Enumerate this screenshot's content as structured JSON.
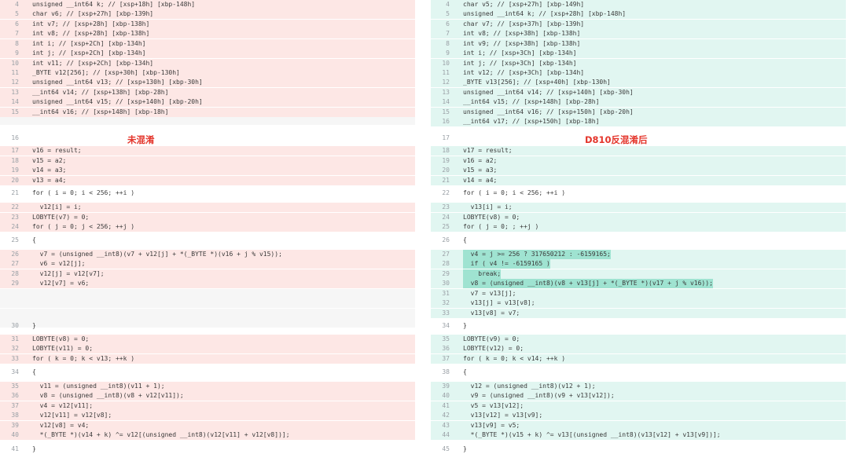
{
  "left_title": "未混淆",
  "right_title": "D810反混淆后",
  "left": [
    {
      "n": "4",
      "t": "unsigned __int64 k; // [xsp+18h] [xbp-148h]",
      "c": "del"
    },
    {
      "n": "5",
      "t": "char v6; // [xsp+27h] [xbp-139h]",
      "c": "del"
    },
    {
      "n": "6",
      "t": "int v7; // [xsp+28h] [xbp-138h]",
      "c": "del"
    },
    {
      "n": "7",
      "t": "int v8; // [xsp+28h] [xbp-138h]",
      "c": "del"
    },
    {
      "n": "8",
      "t": "int i; // [xsp+2Ch] [xbp-134h]",
      "c": "del"
    },
    {
      "n": "9",
      "t": "int j; // [xsp+2Ch] [xbp-134h]",
      "c": "del"
    },
    {
      "n": "10",
      "t": "int v11; // [xsp+2Ch] [xbp-134h]",
      "c": "del"
    },
    {
      "n": "11",
      "t": "_BYTE v12[256]; // [xsp+30h] [xbp-130h]",
      "c": "del"
    },
    {
      "n": "12",
      "t": "unsigned __int64 v13; // [xsp+130h] [xbp-30h]",
      "c": "del"
    },
    {
      "n": "13",
      "t": "__int64 v14; // [xsp+138h] [xbp-28h]",
      "c": "del"
    },
    {
      "n": "14",
      "t": "unsigned __int64 v15; // [xsp+140h] [xbp-20h]",
      "c": "del"
    },
    {
      "n": "15",
      "t": "__int64 v16; // [xsp+148h] [xbp-18h]",
      "c": "del"
    },
    {
      "n": "",
      "t": "",
      "c": "gap"
    },
    {
      "n": "16",
      "t": "",
      "c": ""
    },
    {
      "n": "17",
      "t": "v16 = result;",
      "c": "del"
    },
    {
      "n": "18",
      "t": "v15 = a2;",
      "c": "del"
    },
    {
      "n": "19",
      "t": "v14 = a3;",
      "c": "del"
    },
    {
      "n": "20",
      "t": "v13 = a4;",
      "c": "del"
    },
    {
      "n": "21",
      "t": "for ( i = 0; i < 256; ++i )",
      "c": ""
    },
    {
      "n": "22",
      "t": "  v12[i] = i;",
      "c": "del"
    },
    {
      "n": "23",
      "t": "LOBYTE(v7) = 0;",
      "c": "del"
    },
    {
      "n": "24",
      "t": "for ( j = 0; j < 256; ++j )",
      "c": "del"
    },
    {
      "n": "25",
      "t": "{",
      "c": ""
    },
    {
      "n": "26",
      "t": "  v7 = (unsigned __int8)(v7 + v12[j] + *(_BYTE *)(v16 + j % v15));",
      "c": "del"
    },
    {
      "n": "27",
      "t": "  v6 = v12[j];",
      "c": "del"
    },
    {
      "n": "28",
      "t": "  v12[j] = v12[v7];",
      "c": "del"
    },
    {
      "n": "29",
      "t": "  v12[v7] = v6;",
      "c": "del"
    },
    {
      "n": "",
      "t": "",
      "c": "gap"
    },
    {
      "n": "",
      "t": "",
      "c": "gap"
    },
    {
      "n": "",
      "t": "",
      "c": "gap"
    },
    {
      "n": "",
      "t": "",
      "c": "gap"
    },
    {
      "n": "30",
      "t": "}",
      "c": ""
    },
    {
      "n": "31",
      "t": "LOBYTE(v8) = 0;",
      "c": "del"
    },
    {
      "n": "32",
      "t": "LOBYTE(v11) = 0;",
      "c": "del"
    },
    {
      "n": "33",
      "t": "for ( k = 0; k < v13; ++k )",
      "c": "del"
    },
    {
      "n": "34",
      "t": "{",
      "c": ""
    },
    {
      "n": "35",
      "t": "  v11 = (unsigned __int8)(v11 + 1);",
      "c": "del"
    },
    {
      "n": "36",
      "t": "  v8 = (unsigned __int8)(v8 + v12[v11]);",
      "c": "del"
    },
    {
      "n": "37",
      "t": "  v4 = v12[v11];",
      "c": "del"
    },
    {
      "n": "38",
      "t": "  v12[v11] = v12[v8];",
      "c": "del"
    },
    {
      "n": "39",
      "t": "  v12[v8] = v4;",
      "c": "del"
    },
    {
      "n": "40",
      "t": "  *(_BYTE *)(v14 + k) ^= v12[(unsigned __int8)(v12[v11] + v12[v8])];",
      "c": "del"
    },
    {
      "n": "41",
      "t": "}",
      "c": ""
    }
  ],
  "right": [
    {
      "n": "4",
      "t": "char v5; // [xsp+27h] [xbp-149h]",
      "c": "add"
    },
    {
      "n": "5",
      "t": "unsigned __int64 k; // [xsp+28h] [xbp-148h]",
      "c": "add"
    },
    {
      "n": "6",
      "t": "char v7; // [xsp+37h] [xbp-139h]",
      "c": "add"
    },
    {
      "n": "7",
      "t": "int v8; // [xsp+38h] [xbp-138h]",
      "c": "add"
    },
    {
      "n": "8",
      "t": "int v9; // [xsp+38h] [xbp-138h]",
      "c": "add"
    },
    {
      "n": "9",
      "t": "int i; // [xsp+3Ch] [xbp-134h]",
      "c": "add"
    },
    {
      "n": "10",
      "t": "int j; // [xsp+3Ch] [xbp-134h]",
      "c": "add"
    },
    {
      "n": "11",
      "t": "int v12; // [xsp+3Ch] [xbp-134h]",
      "c": "add"
    },
    {
      "n": "12",
      "t": "_BYTE v13[256]; // [xsp+40h] [xbp-130h]",
      "c": "add"
    },
    {
      "n": "13",
      "t": "unsigned __int64 v14; // [xsp+140h] [xbp-30h]",
      "c": "add"
    },
    {
      "n": "14",
      "t": "__int64 v15; // [xsp+148h] [xbp-28h]",
      "c": "add"
    },
    {
      "n": "15",
      "t": "unsigned __int64 v16; // [xsp+150h] [xbp-20h]",
      "c": "add"
    },
    {
      "n": "16",
      "t": "__int64 v17; // [xsp+150h] [xbp-18h]",
      "c": "add"
    },
    {
      "n": "17",
      "t": "",
      "c": ""
    },
    {
      "n": "18",
      "t": "v17 = result;",
      "c": "add"
    },
    {
      "n": "19",
      "t": "v16 = a2;",
      "c": "add"
    },
    {
      "n": "20",
      "t": "v15 = a3;",
      "c": "add"
    },
    {
      "n": "21",
      "t": "v14 = a4;",
      "c": "add"
    },
    {
      "n": "22",
      "t": "for ( i = 0; i < 256; ++i )",
      "c": ""
    },
    {
      "n": "23",
      "t": "  v13[i] = i;",
      "c": "add"
    },
    {
      "n": "24",
      "t": "LOBYTE(v8) = 0;",
      "c": "add"
    },
    {
      "n": "25",
      "t": "for ( j = 0; ; ++j )",
      "c": "add"
    },
    {
      "n": "26",
      "t": "{",
      "c": ""
    },
    {
      "n": "27",
      "t": "  v4 = j >= 256 ? 317650212 : -6159165;",
      "c": "add"
    },
    {
      "n": "28",
      "t": "  if ( v4 != -6159165 )",
      "c": "add"
    },
    {
      "n": "29",
      "t": "    break;",
      "c": "add"
    },
    {
      "n": "30",
      "t": "  v8 = (unsigned __int8)(v8 + v13[j] + *(_BYTE *)(v17 + j % v16));",
      "c": "add"
    },
    {
      "n": "31",
      "t": "  v7 = v13[j];",
      "c": "add"
    },
    {
      "n": "32",
      "t": "  v13[j] = v13[v8];",
      "c": "add"
    },
    {
      "n": "33",
      "t": "  v13[v8] = v7;",
      "c": "add"
    },
    {
      "n": "34",
      "t": "}",
      "c": ""
    },
    {
      "n": "35",
      "t": "LOBYTE(v9) = 0;",
      "c": "add"
    },
    {
      "n": "36",
      "t": "LOBYTE(v12) = 0;",
      "c": "add"
    },
    {
      "n": "37",
      "t": "for ( k = 0; k < v14; ++k )",
      "c": "add"
    },
    {
      "n": "38",
      "t": "{",
      "c": ""
    },
    {
      "n": "39",
      "t": "  v12 = (unsigned __int8)(v12 + 1);",
      "c": "add"
    },
    {
      "n": "40",
      "t": "  v9 = (unsigned __int8)(v9 + v13[v12]);",
      "c": "add"
    },
    {
      "n": "41",
      "t": "  v5 = v13[v12];",
      "c": "add"
    },
    {
      "n": "42",
      "t": "  v13[v12] = v13[v9];",
      "c": "add"
    },
    {
      "n": "43",
      "t": "  v13[v9] = v5;",
      "c": "add"
    },
    {
      "n": "44",
      "t": "  *(_BYTE *)(v15 + k) ^= v13[(unsigned __int8)(v13[v12] + v13[v9])];",
      "c": "add"
    },
    {
      "n": "45",
      "t": "}",
      "c": ""
    }
  ],
  "colors": {
    "deleted_bg": "#fde7e5",
    "added_bg": "#e1f6f1",
    "title": "#e4352b"
  },
  "icons": {
    "corner": "comment-icon"
  }
}
